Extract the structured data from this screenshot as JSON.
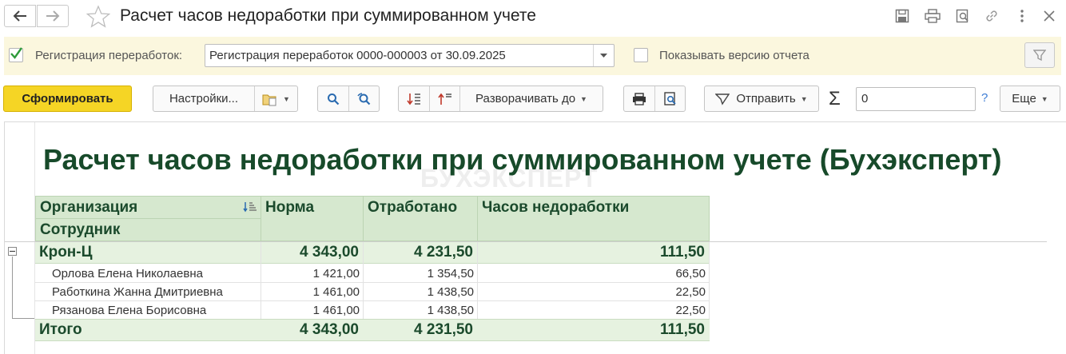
{
  "window": {
    "title": "Расчет часов недоработки при суммированном учете"
  },
  "params": {
    "registration_checked": true,
    "registration_label": "Регистрация переработок:",
    "registration_value": "Регистрация переработок 0000-000003 от 30.09.2025",
    "show_version_checked": false,
    "show_version_label": "Показывать версию отчета"
  },
  "toolbar": {
    "generate_label": "Сформировать",
    "settings_label": "Настройки...",
    "expand_label": "Разворачивать до",
    "send_label": "Отправить",
    "sum_value": "0",
    "help_label": "?",
    "more_label": "Еще"
  },
  "report": {
    "title": "Расчет часов недоработки при суммированном учете (Бухэксперт)",
    "watermark": "БУХЭКСПЕРТ",
    "headers": {
      "organization": "Организация",
      "employee": "Сотрудник",
      "norm": "Норма",
      "worked": "Отработано",
      "shortfall": "Часов недоработки"
    },
    "group": {
      "name": "Крон-Ц",
      "norm": "4 343,00",
      "worked": "4 231,50",
      "shortfall": "111,50"
    },
    "rows": [
      {
        "name": "Орлова Елена Николаевна",
        "norm": "1 421,00",
        "worked": "1 354,50",
        "shortfall": "66,50"
      },
      {
        "name": "Работкина Жанна Дмитриевна",
        "norm": "1 461,00",
        "worked": "1 438,50",
        "shortfall": "22,50"
      },
      {
        "name": "Рязанова Елена Борисовна",
        "norm": "1 461,00",
        "worked": "1 438,50",
        "shortfall": "22,50"
      }
    ],
    "total": {
      "label": "Итого",
      "norm": "4 343,00",
      "worked": "4 231,50",
      "shortfall": "111,50"
    }
  },
  "colors": {
    "header_bg": "#d6e8cf",
    "group_bg": "#e6f2e0",
    "title_color": "#174a2a",
    "primary_button": "#f5d525",
    "params_bg": "#fbf7de"
  }
}
